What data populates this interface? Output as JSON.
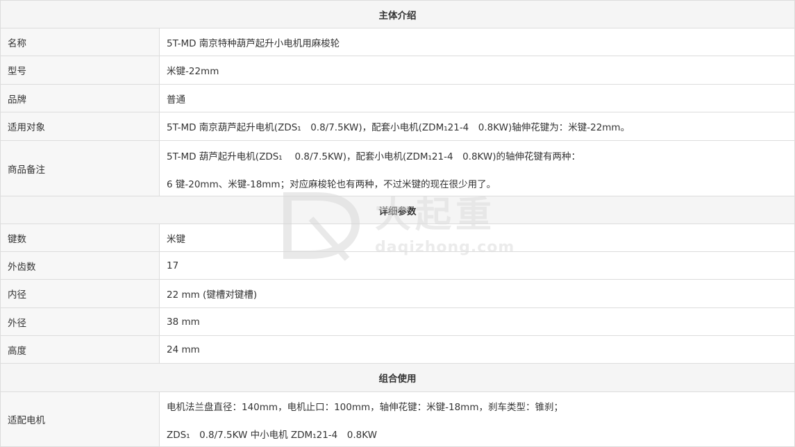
{
  "sections": [
    {
      "title": "主体介绍"
    },
    {
      "title": "详细参数"
    },
    {
      "title": "组合使用"
    }
  ],
  "rows": [
    {
      "label": "名称",
      "lines": [
        "5T-MD 南京特种葫芦起升小电机用麻梭轮"
      ]
    },
    {
      "label": "型号",
      "lines": [
        "米键-22mm"
      ]
    },
    {
      "label": "品牌",
      "lines": [
        "普通"
      ]
    },
    {
      "label": "适用对象",
      "lines": [
        "5T-MD 南京葫芦起升电机(ZDS₁　0.8/7.5KW)，配套小电机(ZDM₁21-4　0.8KW)轴伸花键为：米键-22mm。"
      ]
    },
    {
      "label": "商品备注",
      "lines": [
        "5T-MD 葫芦起升电机(ZDS₁　 0.8/7.5KW)，配套小电机(ZDM₁21-4　0.8KW)的轴伸花键有两种：",
        "6 键-20mm、米键-18mm；对应麻梭轮也有两种，不过米键的现在很少用了。"
      ]
    },
    {
      "label": "键数",
      "lines": [
        "米键"
      ]
    },
    {
      "label": "外齿数",
      "lines": [
        "17"
      ]
    },
    {
      "label": "内径",
      "lines": [
        "22 mm (键槽对键槽)"
      ]
    },
    {
      "label": "外径",
      "lines": [
        "38 mm"
      ]
    },
    {
      "label": "高度",
      "lines": [
        "24 mm"
      ]
    },
    {
      "label": "适配电机",
      "lines": [
        "电机法兰盘直径：140mm，电机止口：100mm，轴伸花键：米键-18mm，刹车类型：锥刹；",
        "ZDS₁　0.8/7.5KW  中小电机 ZDM₁21-4　0.8KW"
      ]
    }
  ],
  "watermark": {
    "brand": "大起重",
    "domain": "daqizhong.com"
  },
  "colors": {
    "border": "#dcdcdc",
    "label_bg": "#f7f7f7",
    "section_bg": "#f5f5f5",
    "text": "#333333"
  }
}
